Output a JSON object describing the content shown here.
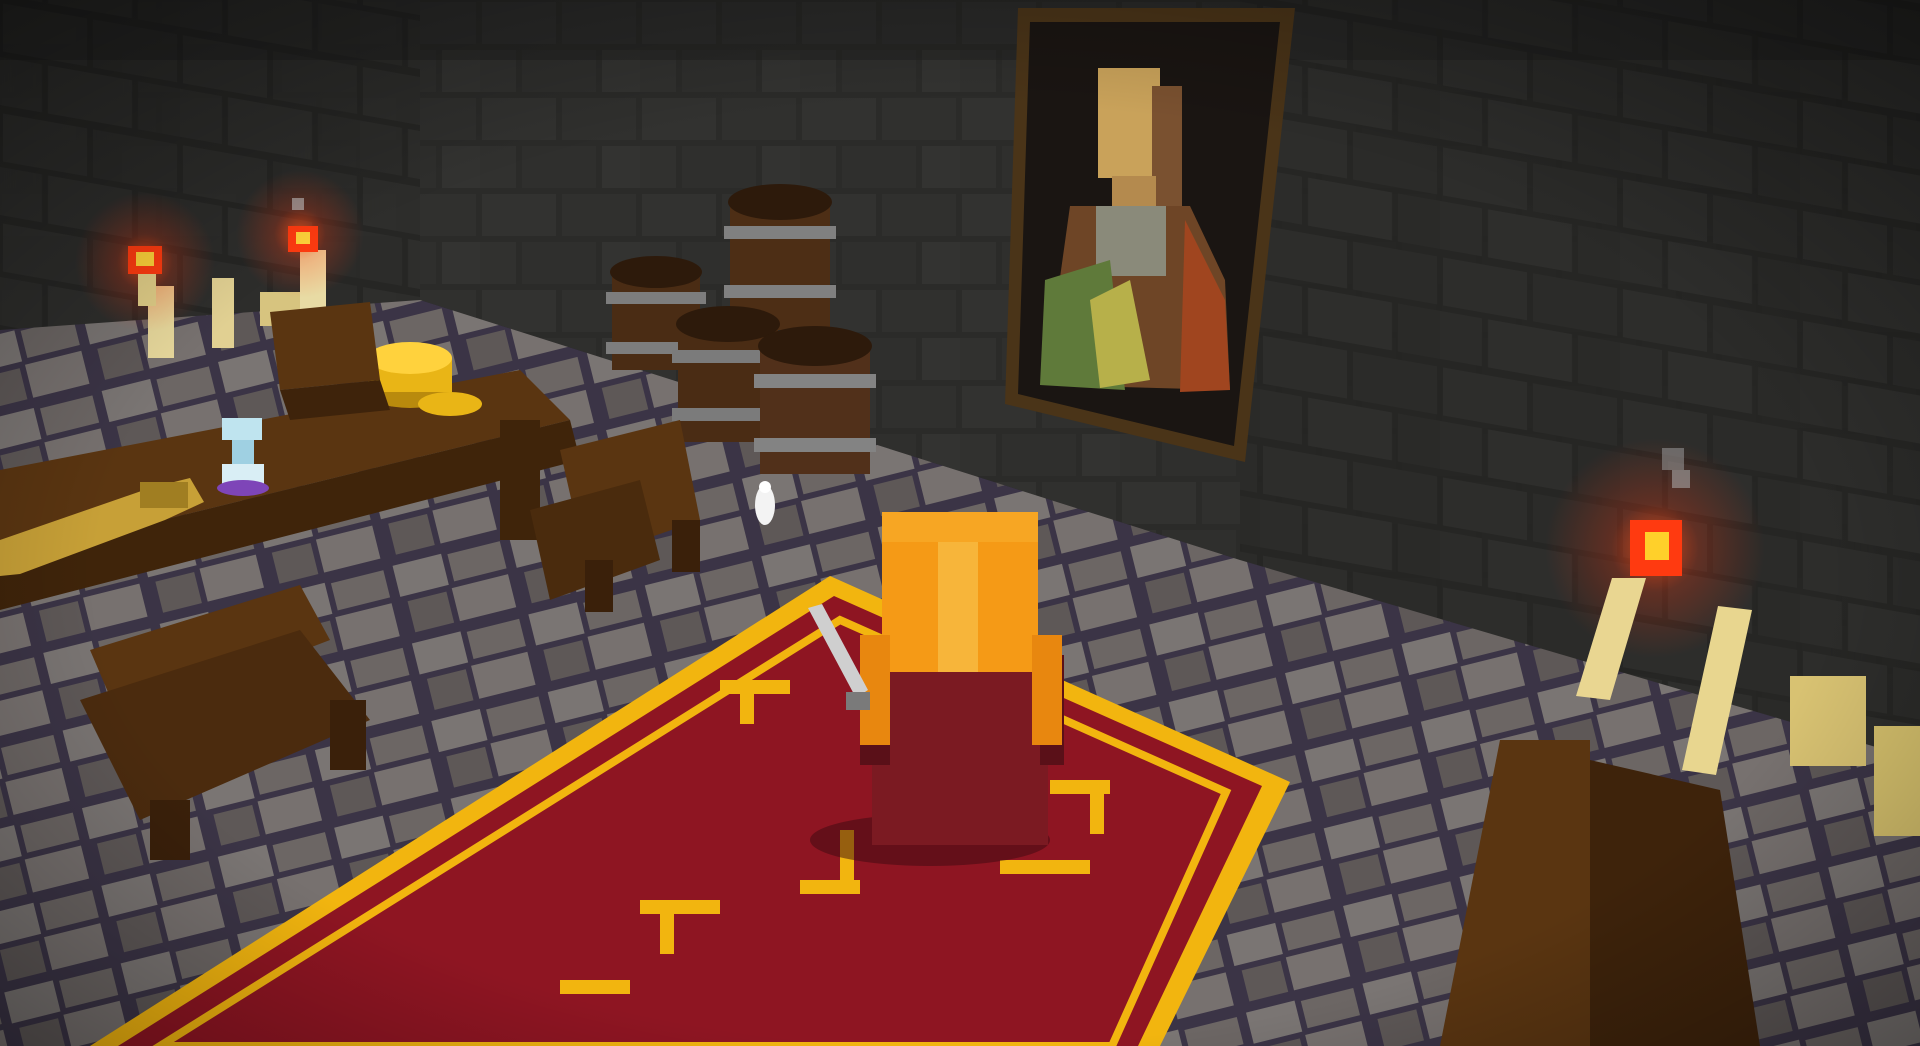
{
  "scene": {
    "kind": "voxel-dungeon-room",
    "camera": "third-person-behind-player",
    "objects": [
      "brick-wall",
      "stone-tile-floor",
      "wall-torch",
      "wall-torch",
      "wall-torch",
      "candle",
      "wooden-table",
      "wooden-chair",
      "wooden-chair",
      "wooden-chair",
      "gold-coin-stack",
      "potion-bottle",
      "key",
      "barrel",
      "barrel",
      "barrel",
      "barrel",
      "framed-portrait",
      "red-carpet",
      "player-character",
      "sword",
      "spirit-wisp"
    ],
    "colors": {
      "wall": "#2a2a28",
      "wall_brick_edge": "#1c1c1b",
      "floor_mortar": "#3b3446",
      "floor_tile": "#6e6866",
      "carpet": "#8e1522",
      "carpet_trim": "#f2b50f",
      "wood": "#5a3511",
      "player_hair": "#f59a16",
      "torch_flame": "#ff3b10",
      "gold": "#e9b516",
      "portrait_frame": "#4a3418"
    }
  }
}
